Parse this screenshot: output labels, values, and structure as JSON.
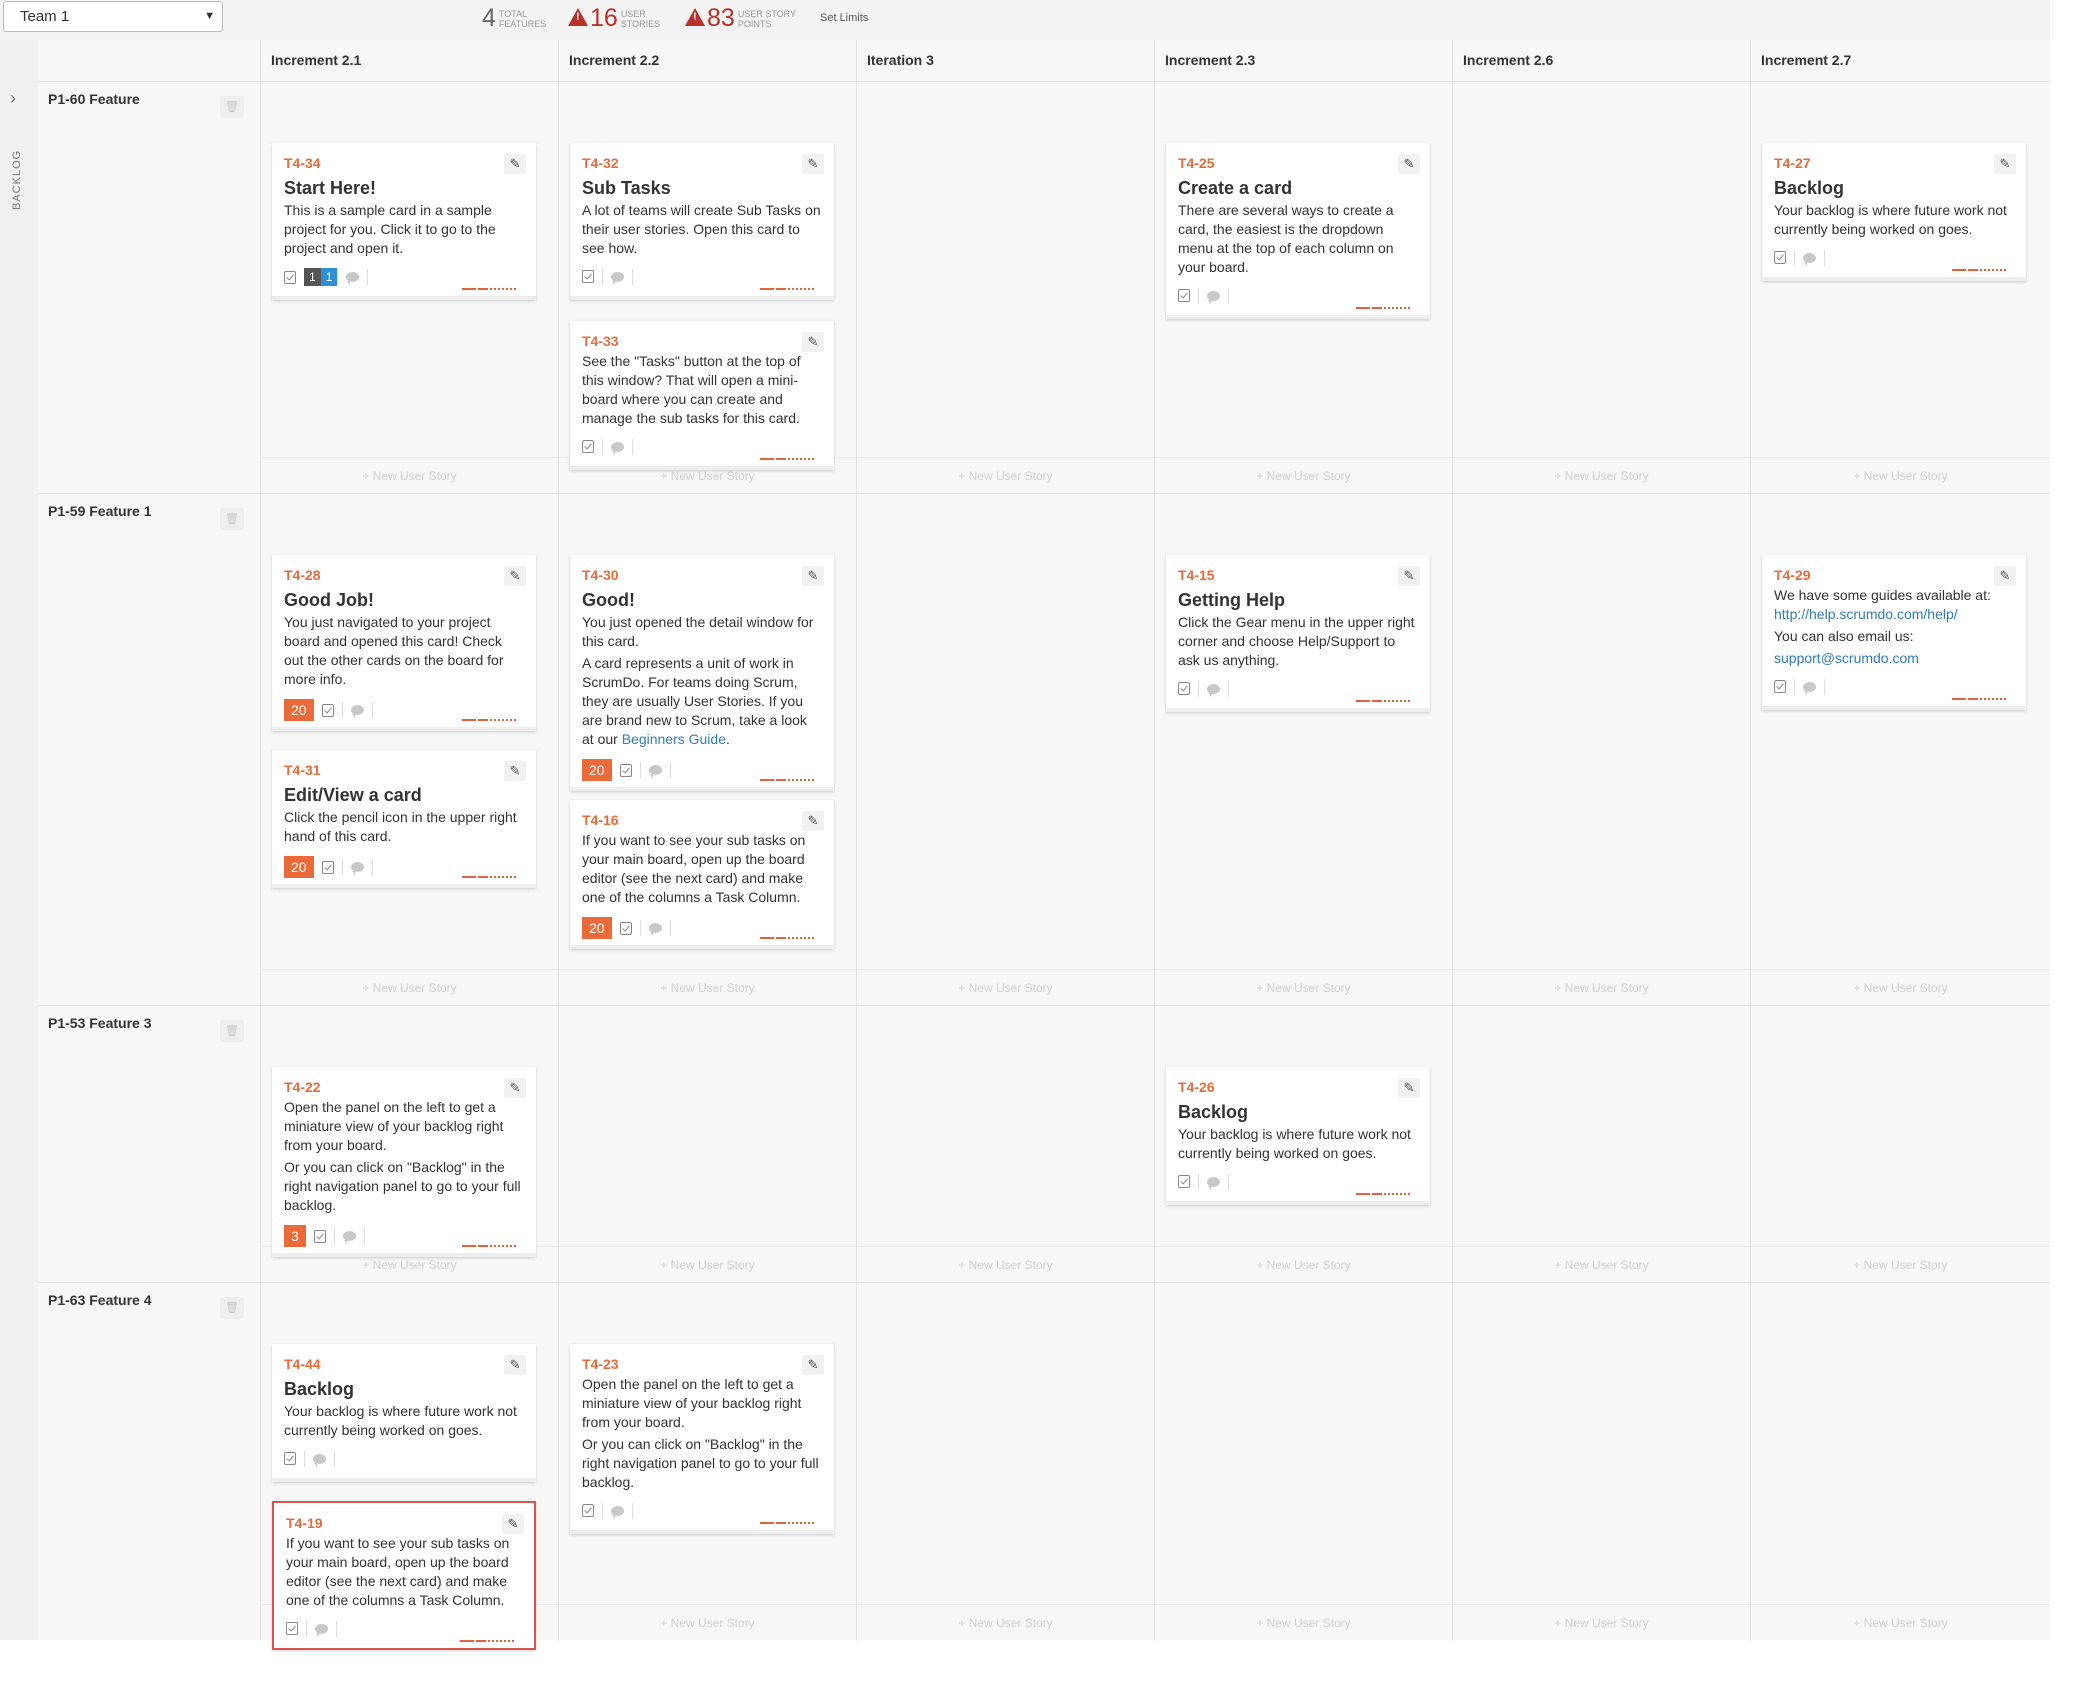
{
  "header": {
    "team": "Team 1",
    "stats": [
      {
        "value": "4",
        "label1": "TOTAL",
        "label2": "FEATURES",
        "warning": false
      },
      {
        "value": "16",
        "label1": "USER",
        "label2": "STORIES",
        "warning": true
      },
      {
        "value": "83",
        "label1": "USER STORY",
        "label2": "POINTS",
        "warning": true
      }
    ],
    "set_limits": "Set Limits"
  },
  "backlog_label": "BACKLOG",
  "new_story_label": "+ New User Story",
  "columns": [
    {
      "label": "Increment 2.1"
    },
    {
      "label": "Increment 2.2"
    },
    {
      "label": "Iteration 3"
    },
    {
      "label": "Increment 2.3"
    },
    {
      "label": "Increment 2.6"
    },
    {
      "label": "Increment 2.7"
    }
  ],
  "lanes": [
    {
      "label": "P1-60 Feature",
      "cells": [
        [
          {
            "id": "T4-34",
            "title": "Start Here!",
            "desc": [
              "This is a sample card in a sample project for you. Click it to go to the project and open it."
            ],
            "chips": [
              "1",
              "1"
            ]
          }
        ],
        [
          {
            "id": "T4-32",
            "title": "Sub Tasks",
            "desc": [
              "A lot of teams will create Sub Tasks on their user stories.  Open this card to see how."
            ]
          },
          {
            "id": "T4-33",
            "title": "",
            "desc": [
              "See the \"Tasks\" button at the top of this window?  That will open a mini-board where you can create and manage the sub tasks for this card."
            ]
          }
        ],
        [],
        [
          {
            "id": "T4-25",
            "title": "Create a card",
            "desc": [
              "There are several ways to create a card, the easiest is the dropdown menu at the top of each column on your board."
            ]
          }
        ],
        [],
        [
          {
            "id": "T4-27",
            "title": "Backlog",
            "desc": [
              "Your backlog is where future work not currently being worked on goes."
            ]
          }
        ]
      ]
    },
    {
      "label": "P1-59 Feature 1",
      "cells": [
        [
          {
            "id": "T4-28",
            "title": "Good Job!",
            "desc": [
              "You just navigated to your project board and opened this card! Check out the other cards on the board for more info."
            ],
            "points": "20"
          },
          {
            "id": "T4-31",
            "title": "Edit/View a card",
            "desc": [
              "Click the pencil icon in the upper right hand of this card."
            ],
            "points": "20"
          }
        ],
        [
          {
            "id": "T4-30",
            "title": "Good!",
            "desc": [
              "You just opened the detail window for this card.",
              "A card represents a unit of work in ScrumDo.  For teams doing Scrum, they are usually User Stories.  If you are brand new to Scrum, take a look at our "
            ],
            "link": "Beginners Guide",
            "link_suffix": ".",
            "points": "20"
          },
          {
            "id": "T4-16",
            "title": "",
            "desc": [
              "If you want to see your sub tasks on your main board, open up the board editor (see the next card) and make one of the columns a Task Column."
            ],
            "points": "20"
          }
        ],
        [],
        [
          {
            "id": "T4-15",
            "title": "Getting Help",
            "desc": [
              "Click the Gear menu in the upper right corner and choose Help/Support to ask us anything."
            ]
          }
        ],
        [],
        [
          {
            "id": "T4-29",
            "title": "",
            "desc_prefix": "We have some guides available at: ",
            "link": "http://help.scrumdo.com/help/",
            "desc": [
              "You can also email us:"
            ],
            "link2": "support@scrumdo.com"
          }
        ]
      ]
    },
    {
      "label": "P1-53 Feature 3",
      "cells": [
        [
          {
            "id": "T4-22",
            "title": "",
            "desc": [
              "Open the panel on the left to get a miniature view of your backlog right from your board.",
              "Or you can click on \"Backlog\" in the right navigation panel to go to your full backlog."
            ],
            "points": "3"
          }
        ],
        [],
        [],
        [
          {
            "id": "T4-26",
            "title": "Backlog",
            "desc": [
              "Your backlog is where future work not currently being worked on goes."
            ]
          }
        ],
        [],
        []
      ]
    },
    {
      "label": "P1-63 Feature 4",
      "cells": [
        [
          {
            "id": "T4-44",
            "title": "Backlog",
            "desc": [
              "Your backlog is where future work not currently being worked on goes."
            ],
            "no_progress": true
          },
          {
            "id": "T4-19",
            "title": "",
            "desc": [
              "If you want to see your sub tasks on your main board, open up the board editor (see the next card) and make one of the columns a Task Column."
            ],
            "selected": true
          }
        ],
        [
          {
            "id": "T4-23",
            "title": "",
            "desc": [
              "Open the panel on the left to get a miniature view of your backlog right from your board.",
              "Or you can click on \"Backlog\" in the right navigation panel to go to your full backlog."
            ]
          }
        ],
        [],
        [],
        [],
        []
      ]
    }
  ],
  "colors": {
    "accent": "#ea6a3a",
    "link": "#2f7dc1",
    "warning": "#b8322a"
  },
  "icons": {
    "edit": "pencil-icon",
    "tasks": "task-checklist-icon",
    "comments": "comment-icon",
    "expand": "chevron-right-icon",
    "delete": "trash-icon"
  }
}
